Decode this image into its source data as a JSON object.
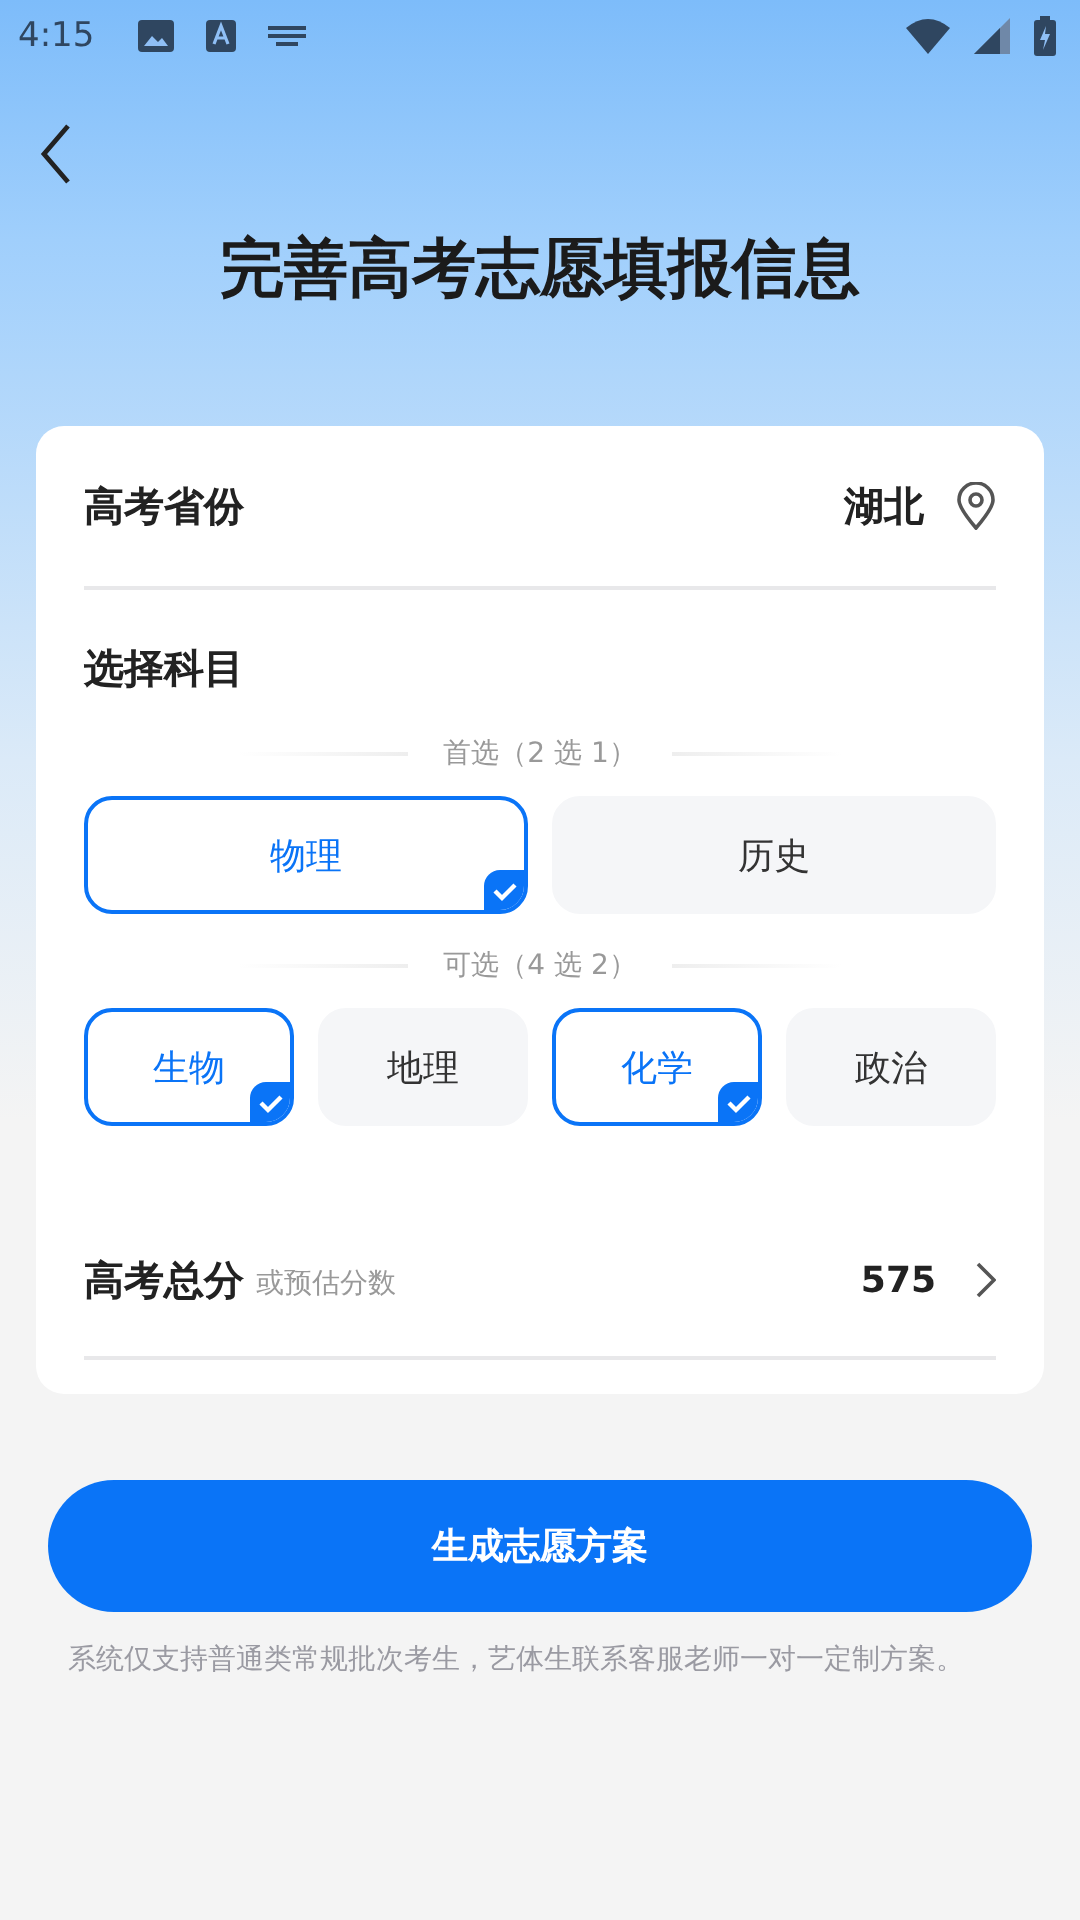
{
  "status_bar": {
    "time": "4:15"
  },
  "title": "完善高考志愿填报信息",
  "province": {
    "label": "高考省份",
    "value": "湖北"
  },
  "subjects": {
    "label": "选择科目",
    "groups": [
      {
        "caption": "首选（2 选 1）",
        "items": [
          {
            "name": "物理",
            "selected": true
          },
          {
            "name": "历史",
            "selected": false
          }
        ]
      },
      {
        "caption": "可选（4 选 2）",
        "items": [
          {
            "name": "生物",
            "selected": true
          },
          {
            "name": "地理",
            "selected": false
          },
          {
            "name": "化学",
            "selected": true
          },
          {
            "name": "政治",
            "selected": false
          }
        ]
      }
    ]
  },
  "score": {
    "label": "高考总分",
    "hint": "或预估分数",
    "value": "575"
  },
  "submit_button": "生成志愿方案",
  "note": "系统仅支持普通类常规批次考生，艺体生联系客服老师一对一定制方案。"
}
